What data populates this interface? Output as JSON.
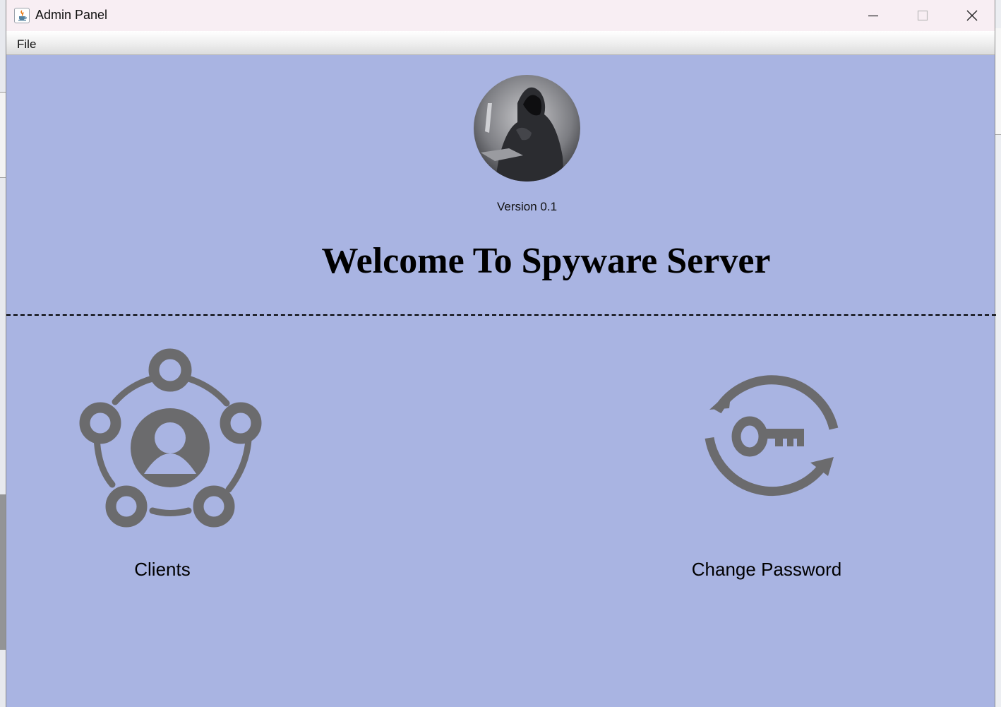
{
  "window": {
    "title": "Admin Panel",
    "app_icon": "java-cup-icon",
    "controls": [
      "minimize-icon",
      "maximize-icon",
      "close-icon"
    ]
  },
  "menubar": {
    "items": [
      {
        "label": "File"
      }
    ]
  },
  "main": {
    "avatar": "hooded-hacker-with-laptop",
    "version": "Version 0.1",
    "welcome": "Welcome To Spyware Server",
    "actions": [
      {
        "label": "Clients",
        "icon": "network-users-icon"
      },
      {
        "label": "Change Password",
        "icon": "key-refresh-icon"
      }
    ]
  },
  "colors": {
    "background": "#a9b4e2",
    "icon": "#6b6b6d",
    "titlebar": "#f8eef3"
  }
}
